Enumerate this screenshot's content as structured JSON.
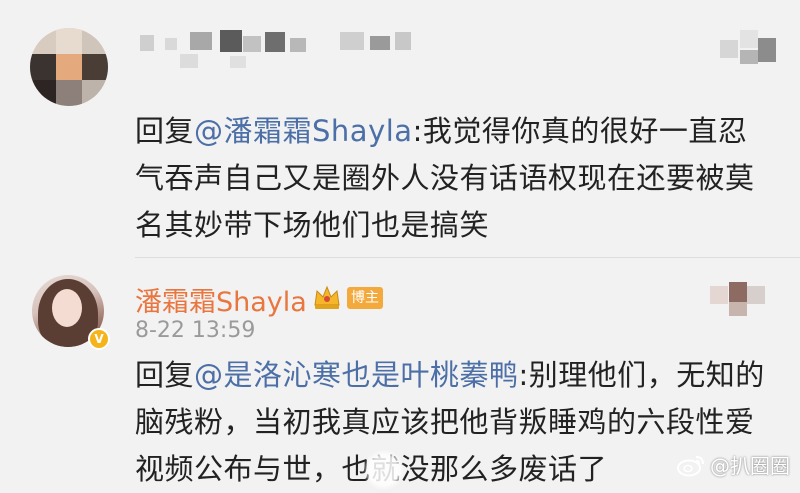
{
  "first_comment": {
    "avatar_icon": "blurred-avatar",
    "username_blurred": true,
    "text_prefix": "回复",
    "mention": "@潘霜霜Shayla",
    "text_body": ":我觉得你真的很好一直忍气吞声自己又是圈外人没有话语权现在还要被莫名其妙带下场他们也是搞笑"
  },
  "second_comment": {
    "avatar_icon": "user-avatar",
    "verified_badge": "V",
    "username": "潘霜霜Shayla",
    "crown_icon": "crown-icon",
    "author_badge": "博主",
    "timestamp": "8-22 13:59",
    "text_prefix": "回复",
    "mention": "@是洛沁寒也是叶桃蓁鸭",
    "text_body": ":别理他们，无知的脑残粉，当初我真应该把他背叛睡鸡的六段性爱视频公布与世，也就没那么多废话了"
  },
  "watermark": {
    "icon": "weibo-icon",
    "text": "@扒圈圈"
  },
  "colors": {
    "background": "#f2f2f2",
    "text": "#222222",
    "mention": "#4b6fa6",
    "username": "#e8763e",
    "badge": "#f3a93b",
    "timestamp": "#9a9a9a"
  }
}
